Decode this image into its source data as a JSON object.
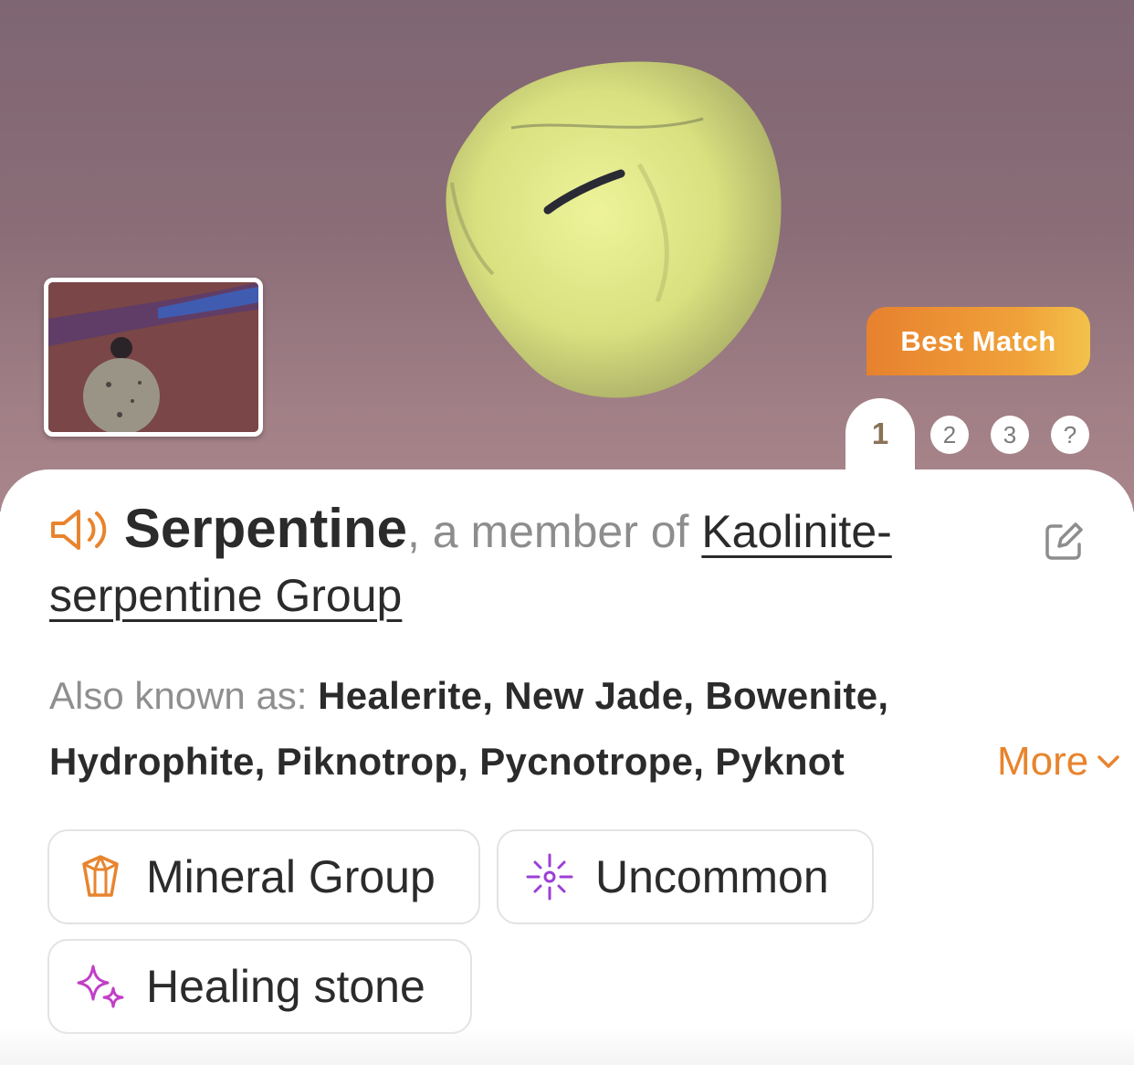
{
  "photo": {
    "best_match_label": "Best Match",
    "match_tabs": [
      "1",
      "2",
      "3",
      "?"
    ],
    "active_tab": "1"
  },
  "identification": {
    "name": "Serpentine",
    "member_prefix": ", a member of ",
    "group_name": "Kaolinite-serpentine Group"
  },
  "aka": {
    "label": "Also known as: ",
    "line1": "Healerite, New Jade, Bowenite,",
    "line2": "Hydrophite, Piknotrop, Pycnotrope, Pyknot",
    "more_label": "More"
  },
  "tags": [
    {
      "label": "Mineral Group",
      "icon": "crystal-icon",
      "color": "#e8842e"
    },
    {
      "label": "Uncommon",
      "icon": "sparkle-burst-icon",
      "color": "#9b3fd6"
    },
    {
      "label": "Healing stone",
      "icon": "sparkles-icon",
      "color": "#c13fc7"
    }
  ],
  "colors": {
    "accent": "#e8842e",
    "text": "#2b2b2b",
    "muted": "#8d8d8d"
  }
}
